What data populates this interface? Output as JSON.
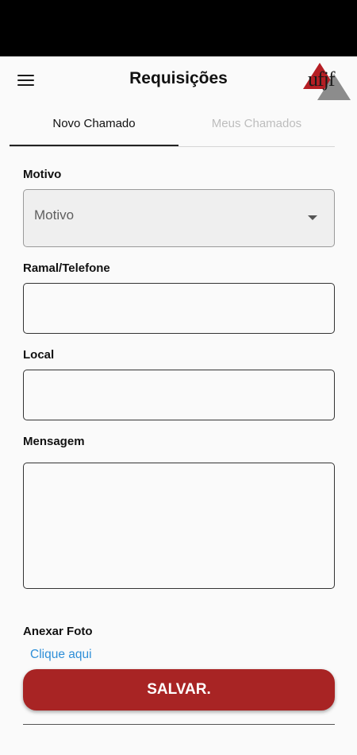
{
  "app_bar": {
    "title": "Requisições",
    "logo_text": "ufjf"
  },
  "tabs": [
    {
      "label": "Novo Chamado",
      "active": true
    },
    {
      "label": "Meus Chamados",
      "active": false
    }
  ],
  "form": {
    "motivo_label": "Motivo",
    "motivo_selected": "Motivo",
    "ramal_label": "Ramal/Telefone",
    "ramal_value": "",
    "local_label": "Local",
    "local_value": "",
    "mensagem_label": "Mensagem",
    "mensagem_value": "",
    "anexar_label": "Anexar Foto",
    "anexar_link": "Clique aqui",
    "save_label": "SALVAR."
  },
  "colors": {
    "accent": "#a82424",
    "link": "#2f8fd8",
    "logo_red": "#b51e24"
  }
}
